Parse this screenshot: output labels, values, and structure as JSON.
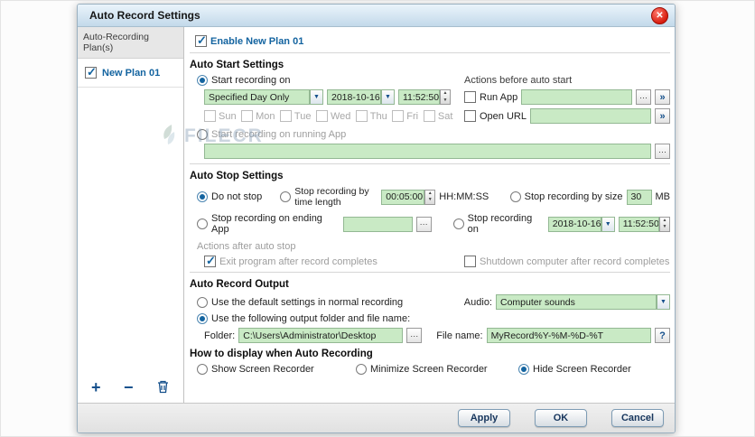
{
  "window": {
    "title": "Auto Record Settings"
  },
  "glyphs": {
    "close": "✕",
    "dots": "···",
    "chevrons": "»",
    "down": "▼",
    "up": "▲",
    "help": "?",
    "plus": "+",
    "minus": "−"
  },
  "sidebar": {
    "header": "Auto-Recording Plan(s)",
    "plan": {
      "label": "New Plan 01",
      "checked": true
    }
  },
  "main": {
    "enable_label": "Enable New Plan 01",
    "enable_checked": true,
    "auto_start": {
      "title": "Auto Start Settings",
      "start_on_label": "Start recording on",
      "start_on_selected": true,
      "actions_label": "Actions before auto start",
      "day_mode": "Specified Day Only",
      "date": "2018-10-16",
      "time": "11:52:50",
      "run_app_label": "Run App",
      "run_app_checked": false,
      "open_url_label": "Open URL",
      "open_url_checked": false,
      "days": [
        "Sun",
        "Mon",
        "Tue",
        "Wed",
        "Thu",
        "Fri",
        "Sat"
      ],
      "running_app_label": "Start recording on running App",
      "running_app_selected": false
    },
    "auto_stop": {
      "title": "Auto Stop Settings",
      "do_not_stop": "Do not stop",
      "do_not_stop_selected": true,
      "by_time": "Stop recording by time length",
      "time_value": "00:05:00",
      "time_format": "HH:MM:SS",
      "by_size": "Stop recording by size",
      "size_value": "30",
      "size_unit": "MB",
      "ending_app": "Stop recording on ending App",
      "stop_on": "Stop recording on",
      "date": "2018-10-16",
      "time": "11:52:50",
      "actions_after": "Actions after auto stop",
      "exit_program": "Exit program after record completes",
      "exit_program_checked": true,
      "shutdown": "Shutdown computer after record completes",
      "shutdown_checked": false
    },
    "output": {
      "title": "Auto Record Output",
      "default_option": "Use the default settings in normal recording",
      "default_selected": false,
      "audio_label": "Audio:",
      "audio_value": "Computer sounds",
      "custom_option": "Use the following output folder and file name:",
      "custom_selected": true,
      "folder_label": "Folder:",
      "folder_value": "C:\\Users\\Administrator\\Desktop",
      "file_label": "File name:",
      "file_value": "MyRecord%Y-%M-%D-%T"
    },
    "display": {
      "title": "How to display when Auto Recording",
      "options": [
        "Show Screen Recorder",
        "Minimize Screen Recorder",
        "Hide Screen Recorder"
      ],
      "selected_index": 2
    }
  },
  "footer": {
    "apply": "Apply",
    "ok": "OK",
    "cancel": "Cancel"
  },
  "watermark": {
    "text": "FILECR"
  }
}
